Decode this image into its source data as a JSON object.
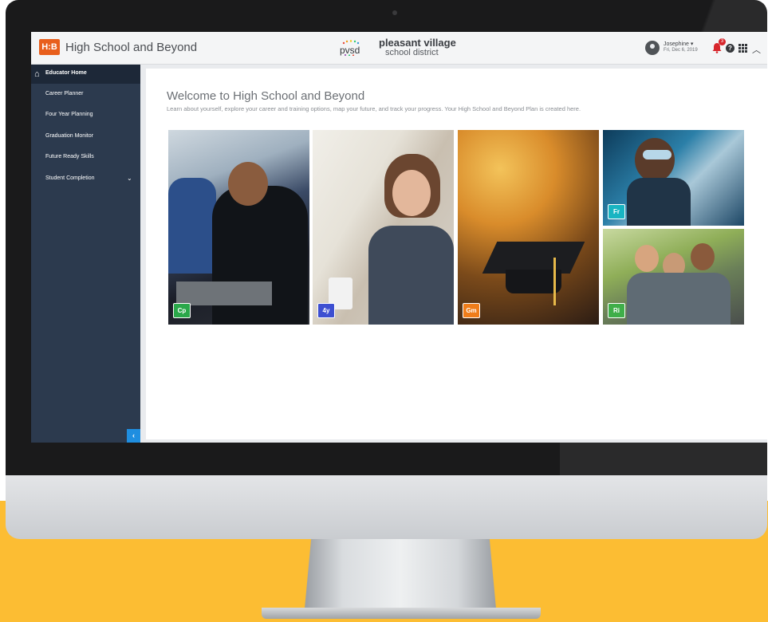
{
  "header": {
    "logo_text": "H:B",
    "app_title": "High School and Beyond",
    "district_logo_text": "pvsd",
    "district_name": "pleasant village",
    "district_sub": "school district",
    "user_name": "Josephine ▾",
    "user_date": "Fri, Dec 6, 2019",
    "notification_count": "3"
  },
  "sidebar": {
    "home_label": "Educator Home",
    "items": [
      {
        "label": "Career Planner"
      },
      {
        "label": "Four Year Planning"
      },
      {
        "label": "Graduation Monitor"
      },
      {
        "label": "Future Ready Skills"
      },
      {
        "label": "Student Completion"
      }
    ],
    "collapse_label": "‹"
  },
  "main": {
    "title": "Welcome to High School and Beyond",
    "subtitle": "Learn about yourself, explore your career and training options, map your future, and track your progress. Your High School and Beyond Plan is created here.",
    "tiles": [
      {
        "code": "Cp",
        "color": "#2aa84a"
      },
      {
        "code": "4y",
        "color": "#3d4fd1"
      },
      {
        "code": "Gm",
        "color": "#f07d1a"
      },
      {
        "code": "Fr",
        "color": "#18b4c2"
      },
      {
        "code": "Ri",
        "color": "#3fae49"
      }
    ]
  },
  "colors": {
    "background": "#fcbd33",
    "sidebar": "#2c3a4e",
    "brand": "#e85f1c"
  },
  "icons": [
    "home-icon",
    "chevron-down-icon",
    "user-icon",
    "bell-icon",
    "help-icon",
    "apps-grid-icon",
    "chevron-up-icon",
    "chevron-left-icon"
  ]
}
